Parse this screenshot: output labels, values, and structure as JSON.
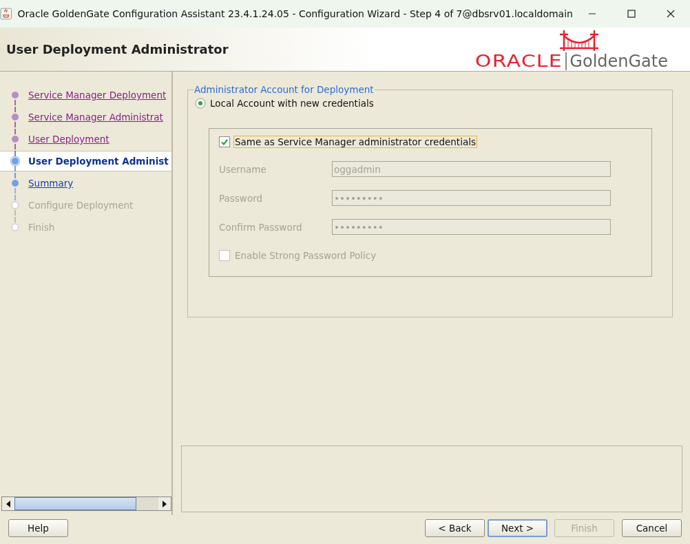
{
  "window": {
    "title": "Oracle GoldenGate Configuration Assistant 23.4.1.24.05 - Configuration Wizard - Step 4 of 7@dbsrv01.localdomain"
  },
  "header": {
    "title": "User Deployment Administrator",
    "logo": {
      "brand": "ORACLE",
      "product": "GoldenGate"
    }
  },
  "steps": [
    {
      "label": "Service Manager Deployment",
      "visited": true,
      "disabled": false,
      "selected": false
    },
    {
      "label": "Service Manager Administrat",
      "visited": true,
      "disabled": false,
      "selected": false
    },
    {
      "label": "User Deployment",
      "visited": true,
      "disabled": false,
      "selected": false
    },
    {
      "label": "User Deployment Administ",
      "visited": false,
      "disabled": false,
      "selected": true
    },
    {
      "label": "Summary",
      "visited": false,
      "disabled": false,
      "selected": false
    },
    {
      "label": "Configure Deployment",
      "visited": false,
      "disabled": true,
      "selected": false
    },
    {
      "label": "Finish",
      "visited": false,
      "disabled": true,
      "selected": false
    }
  ],
  "account_group": {
    "title": "Administrator Account for Deployment",
    "radio": {
      "label": "Local Account with new credentials",
      "selected": true
    },
    "same_credentials": {
      "label": "Same as Service Manager administrator credentials",
      "checked": true,
      "focused": true
    },
    "fields": [
      {
        "label": "Username",
        "value": "oggadmin",
        "disabled": true
      },
      {
        "label": "Password",
        "value": "•••••••••",
        "disabled": true
      },
      {
        "label": "Confirm Password",
        "value": "•••••••••",
        "disabled": true
      }
    ],
    "strong_policy": {
      "label": "Enable Strong Password Policy",
      "checked": false,
      "disabled": true
    }
  },
  "buttons": [
    {
      "label": "Help",
      "kind": "normal",
      "disabled": false
    },
    {
      "label": "< Back",
      "kind": "normal",
      "disabled": false
    },
    {
      "label": "Next >",
      "kind": "default",
      "disabled": false
    },
    {
      "label": "Finish",
      "kind": "normal",
      "disabled": true
    },
    {
      "label": "Cancel",
      "kind": "normal",
      "disabled": false
    }
  ]
}
